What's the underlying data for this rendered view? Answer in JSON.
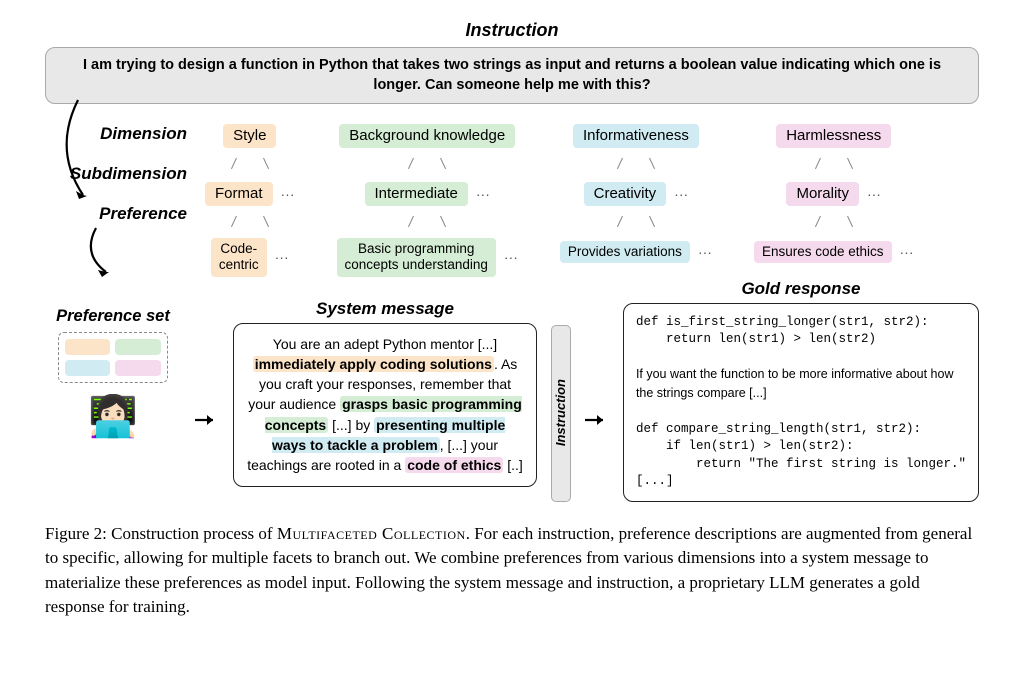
{
  "title_instruction": "Instruction",
  "instruction_text": "I am trying to design a function in Python that takes two strings as input and returns a boolean value indicating which one is longer. Can someone help me with this?",
  "labels": {
    "dimension": "Dimension",
    "subdimension": "Subdimension",
    "preference": "Preference"
  },
  "columns": [
    {
      "color": "orange",
      "dim": "Style",
      "sub": "Format",
      "pref": "Code-\ncentric"
    },
    {
      "color": "green",
      "dim": "Background knowledge",
      "sub": "Intermediate",
      "pref": "Basic programming\nconcepts understanding"
    },
    {
      "color": "blue",
      "dim": "Informativeness",
      "sub": "Creativity",
      "pref": "Provides variations"
    },
    {
      "color": "pink",
      "dim": "Harmlessness",
      "sub": "Morality",
      "pref": "Ensures code ethics"
    }
  ],
  "pref_set_label": "Preference set",
  "sysmsg_title": "System message",
  "sysmsg": {
    "p1": "You are an adept Python mentor [...] ",
    "h1": "immediately apply coding solutions",
    "p2": ". As you craft your responses, remember that your audience ",
    "h2": "grasps basic programming concepts",
    "p3": " [...] by ",
    "h3": "presenting multiple ways to tackle a problem",
    "p4": ", [...] your teachings are rooted in a ",
    "h4": "code of ethics",
    "p5": " [..]"
  },
  "instruction_tag": "Instruction",
  "gold_title": "Gold response",
  "gold": {
    "code1a": "def is_first_string_longer(str1, str2):",
    "code1b": "    return len(str1) > len(str2)",
    "prose": "If you want the function to be more informative about how the strings compare  [...]",
    "code2a": "def compare_string_length(str1, str2):",
    "code2b": "    if len(str1) > len(str2):",
    "code2c": "        return \"The first string is longer.\"",
    "tail": "[...]"
  },
  "caption": {
    "lead": "Figure 2: Construction process of ",
    "name": "Multifaceted Collection",
    "rest": ". For each instruction, preference descriptions are augmented from general to specific, allowing for multiple facets to branch out. We combine preferences from various dimensions into a system message to materialize these preferences as model input. Following the system message and instruction, a proprietary LLM generates a gold response for training."
  }
}
